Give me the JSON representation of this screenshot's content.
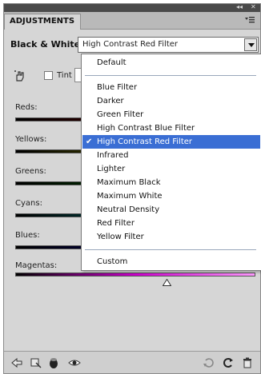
{
  "panel": {
    "title_tab": "ADJUSTMENTS",
    "window_controls": {
      "collapse": "◂◂",
      "close": "✕"
    },
    "menu_icon": "panel-menu-icon"
  },
  "preset": {
    "label": "Black & White",
    "selected": "High Contrast Red Filter"
  },
  "tint": {
    "label": "Tint",
    "checked": false
  },
  "sliders": [
    {
      "label": "Reds:",
      "value": ""
    },
    {
      "label": "Yellows:",
      "value": ""
    },
    {
      "label": "Greens:",
      "value": ""
    },
    {
      "label": "Cyans:",
      "value": ""
    },
    {
      "label": "Blues:",
      "value": ""
    },
    {
      "label": "Magentas:",
      "value": "120",
      "level": 0.63
    }
  ],
  "menu": {
    "items": [
      "Default",
      "Blue Filter",
      "Darker",
      "Green Filter",
      "High Contrast Blue Filter",
      "High Contrast Red Filter",
      "Infrared",
      "Lighter",
      "Maximum Black",
      "Maximum White",
      "Neutral Density",
      "Red Filter",
      "Yellow Filter",
      "Custom"
    ],
    "selected_index": 5,
    "check_glyph": "✔"
  },
  "colors": {
    "selection": "#3a6ed4",
    "panel_bg": "#d6d6d6"
  }
}
